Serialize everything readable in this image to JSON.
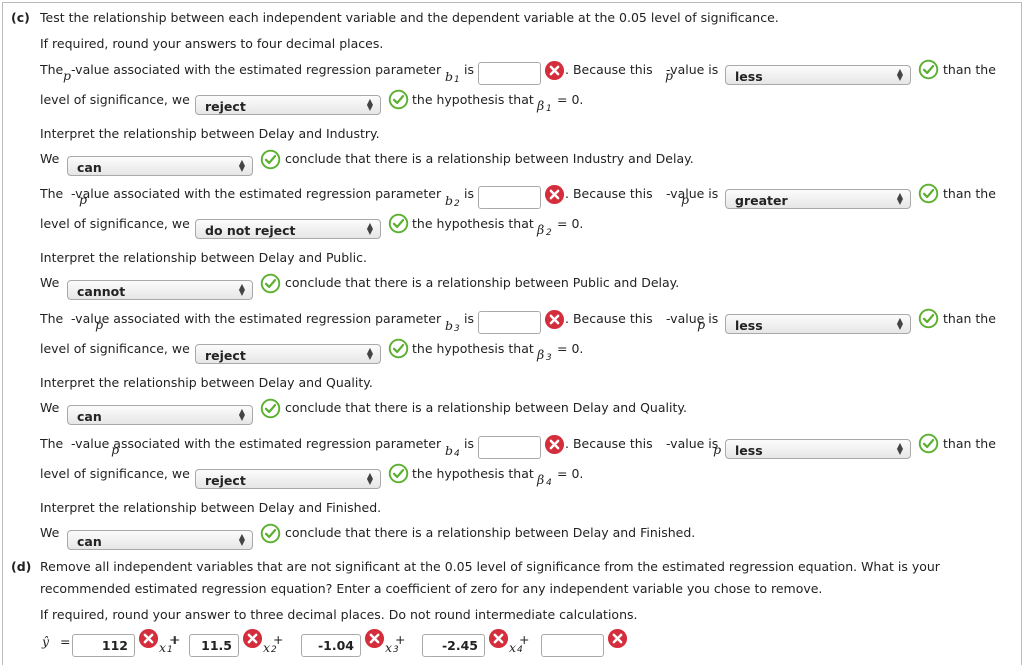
{
  "part_c": {
    "label": "(c)",
    "instruction": "Test the relationship between each independent variable and the dependent variable at the 0.05 level of significance.",
    "rounding": "If required, round your answers to four decimal places.",
    "pvalue_pre": "The",
    "pvalue_p": "p",
    "pvalue_mid": "-value associated with the estimated regression parameter",
    "is": "is",
    "because_pre": ". Because this",
    "because_mid": "-value is",
    "than_the": "than the",
    "level_text": "level of significance, we",
    "hyp_text": "the hypothesis that",
    "eq_zero": "= 0.",
    "we": "We",
    "rows": [
      {
        "b": "b",
        "sub": "1",
        "pvalue": "",
        "compare": "less",
        "decision": "reject",
        "beta": "β",
        "interpret": "Interpret the relationship between Delay and Industry.",
        "we_choice": "can",
        "conclusion": "conclude that there is a relationship between Industry and Delay."
      },
      {
        "b": "b",
        "sub": "2",
        "pvalue": "",
        "compare": "greater",
        "decision": "do not reject",
        "beta": "β",
        "interpret": "Interpret the relationship between Delay and Public.",
        "we_choice": "cannot",
        "conclusion": "conclude that there is a relationship between Public and Delay."
      },
      {
        "b": "b",
        "sub": "3",
        "pvalue": "",
        "compare": "less",
        "decision": "reject",
        "beta": "β",
        "interpret": "Interpret the relationship between Delay and Quality.",
        "we_choice": "can",
        "conclusion": "conclude that there is a relationship between Delay and Quality."
      },
      {
        "b": "b",
        "sub": "4",
        "pvalue": "",
        "compare": "less",
        "decision": "reject",
        "beta": "β",
        "interpret": "Interpret the relationship between Delay and Finished.",
        "we_choice": "can",
        "conclusion": "conclude that there is a relationship between Delay and Finished."
      }
    ]
  },
  "part_d": {
    "label": "(d)",
    "instruction_1": "Remove all independent variables that are not significant at the 0.05 level of significance from the estimated regression equation. What is your",
    "instruction_2": "recommended estimated regression equation? Enter a coefficient of zero for any independent variable you chose to remove.",
    "rounding": "If required, round your answer to three decimal places. Do not round intermediate calculations.",
    "yhat": "ŷ",
    "equals": "=",
    "plus": "+",
    "coefficients": [
      "112",
      "11.5",
      "-1.04",
      "-2.45",
      ""
    ],
    "vars": [
      "x",
      "x",
      "x",
      "x"
    ],
    "var_subs": [
      "1",
      "2",
      "3",
      "4"
    ]
  },
  "colors": {
    "correct": "#5cb030",
    "incorrect": "#d42e3c"
  },
  "icons": {
    "correct": "check-circle-icon",
    "incorrect": "x-circle-icon"
  }
}
